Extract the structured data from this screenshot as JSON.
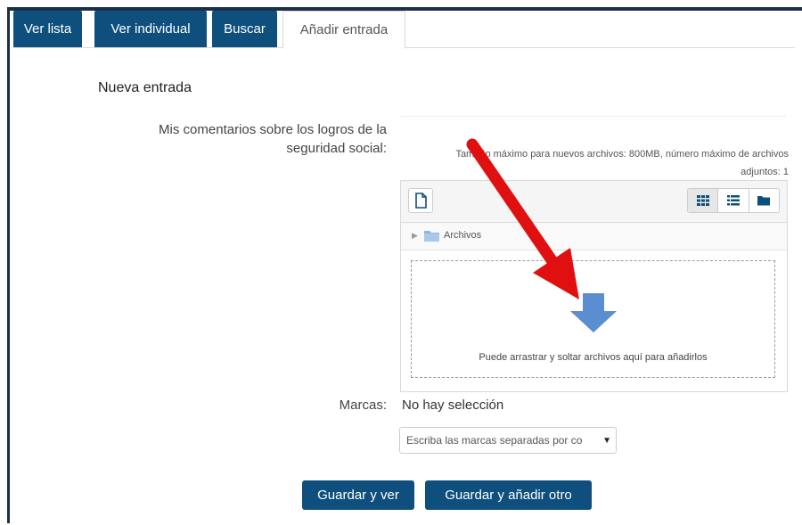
{
  "tabs": [
    {
      "label": "Ver lista",
      "active": false
    },
    {
      "label": "Ver individual",
      "active": false
    },
    {
      "label": "Buscar",
      "active": false
    },
    {
      "label": "Añadir entrada",
      "active": true
    }
  ],
  "form": {
    "section_title": "Nueva entrada",
    "comments_label": "Mis comentarios sobre los logros de la seguridad social:",
    "file_limits": "Tamaño máximo para nuevos archivos: 800MB, número máximo de archivos adjuntos: 1",
    "file_manager": {
      "new_file_icon": "file-add-icon",
      "view_icons": [
        "grid-view-icon",
        "list-view-icon",
        "folder-view-icon"
      ],
      "path_label": "Archivos",
      "drop_text": "Puede arrastrar y soltar archivos aquí para añadirlos"
    },
    "marks_label": "Marcas:",
    "marks_value": "No hay selección",
    "marks_placeholder": "Escriba las marcas separadas por co"
  },
  "buttons": {
    "save_view": "Guardar y ver",
    "save_add": "Guardar y añadir otro"
  },
  "colors": {
    "brand_blue": "#0f4f7d",
    "annotation_red": "#e01010",
    "drop_arrow": "#5b8dd1"
  }
}
